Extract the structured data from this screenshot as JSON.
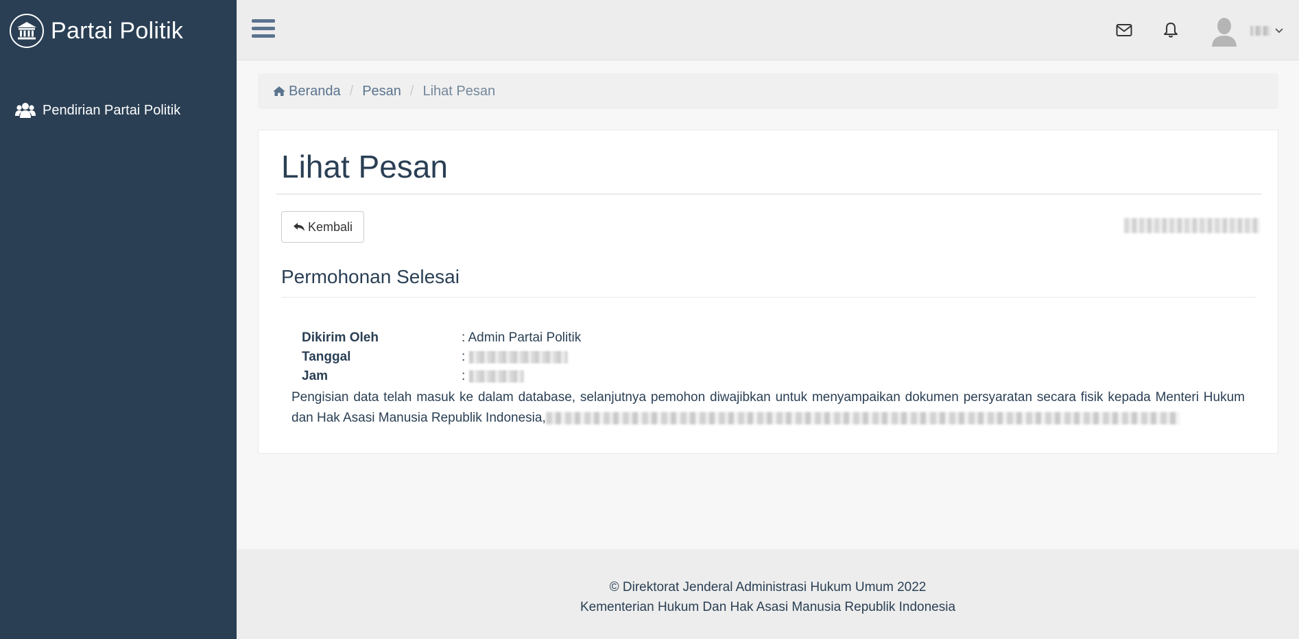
{
  "sidebar": {
    "brand_title": "Partai Politik",
    "brand_icon": "bank-icon",
    "items": [
      {
        "label": "Pendirian Partai Politik",
        "icon": "users-icon"
      }
    ]
  },
  "topnav": {
    "menu_icon": "hamburger-icon",
    "mail_icon": "envelope-icon",
    "bell_icon": "bell-icon",
    "avatar_icon": "user-avatar-icon",
    "dropdown_icon": "chevron-down-icon"
  },
  "breadcrumb": {
    "home_label": "Beranda",
    "home_icon": "home-icon",
    "section_label": "Pesan",
    "current_label": "Lihat Pesan",
    "separator": "/"
  },
  "panel": {
    "title": "Lihat Pesan",
    "back_label": "Kembali",
    "back_icon": "reply-icon"
  },
  "message": {
    "subject": "Permohonan Selesai",
    "sender_label": "Dikirim Oleh",
    "sender_value": ": Admin Partai Politik",
    "date_label": "Tanggal",
    "date_colon": ":",
    "time_label": "Jam",
    "time_colon": ":",
    "body": "Pengisian data telah masuk ke dalam database, selanjutnya pemohon diwajibkan untuk menyampaikan dokumen persyaratan secara fisik kepada Menteri Hukum dan Hak Asasi Manusia Republik Indonesia,"
  },
  "footer": {
    "line1": "© Direktorat Jenderal Administrasi Hukum Umum 2022",
    "line2": "Kementerian Hukum Dan Hak Asasi Manusia Republik Indonesia"
  },
  "colors": {
    "sidebar_bg": "#2a3f54",
    "text_primary": "#2a3f54",
    "link": "#5a738e"
  }
}
